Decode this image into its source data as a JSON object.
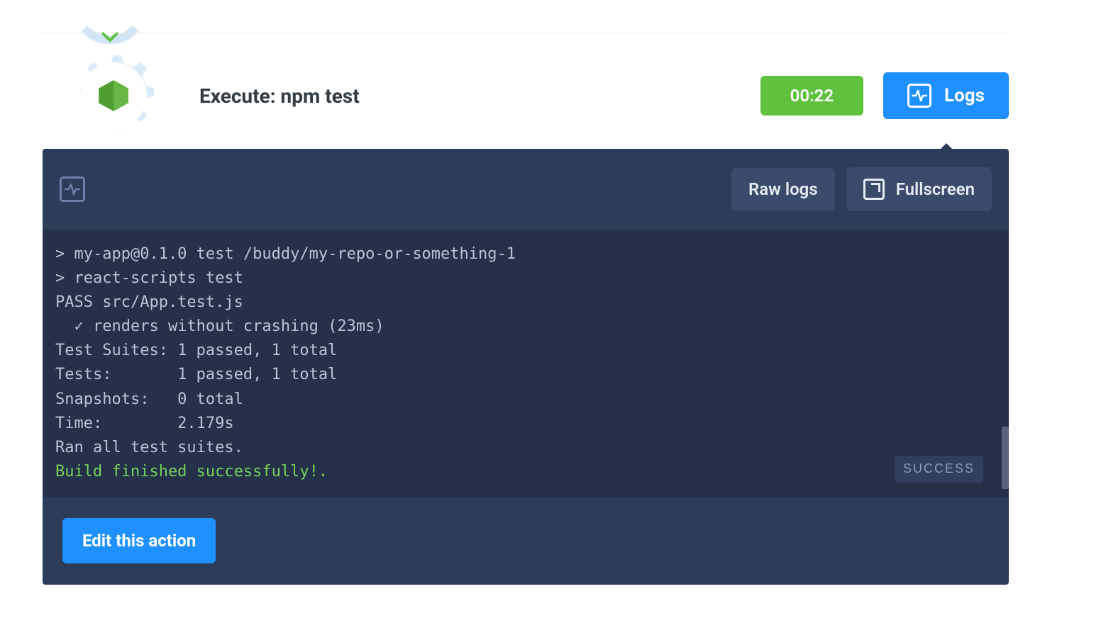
{
  "step": {
    "title": "Execute: npm test",
    "duration": "00:22",
    "logs_label": "Logs"
  },
  "log_header": {
    "raw_logs_label": "Raw logs",
    "fullscreen_label": "Fullscreen"
  },
  "terminal": {
    "lines": [
      "> my-app@0.1.0 test /buddy/my-repo-or-something-1",
      "> react-scripts test",
      "PASS src/App.test.js",
      "  ✓ renders without crashing (23ms)",
      "Test Suites: 1 passed, 1 total",
      "Tests:       1 passed, 1 total",
      "Snapshots:   0 total",
      "Time:        2.179s",
      "Ran all test suites."
    ],
    "success_line": "Build finished successfully!.",
    "status_badge": "SUCCESS"
  },
  "footer": {
    "edit_label": "Edit this action"
  },
  "colors": {
    "accent_blue": "#1e90ff",
    "accent_green": "#5fc13e",
    "panel_dark": "#2d3c58",
    "terminal_bg": "#253049"
  }
}
